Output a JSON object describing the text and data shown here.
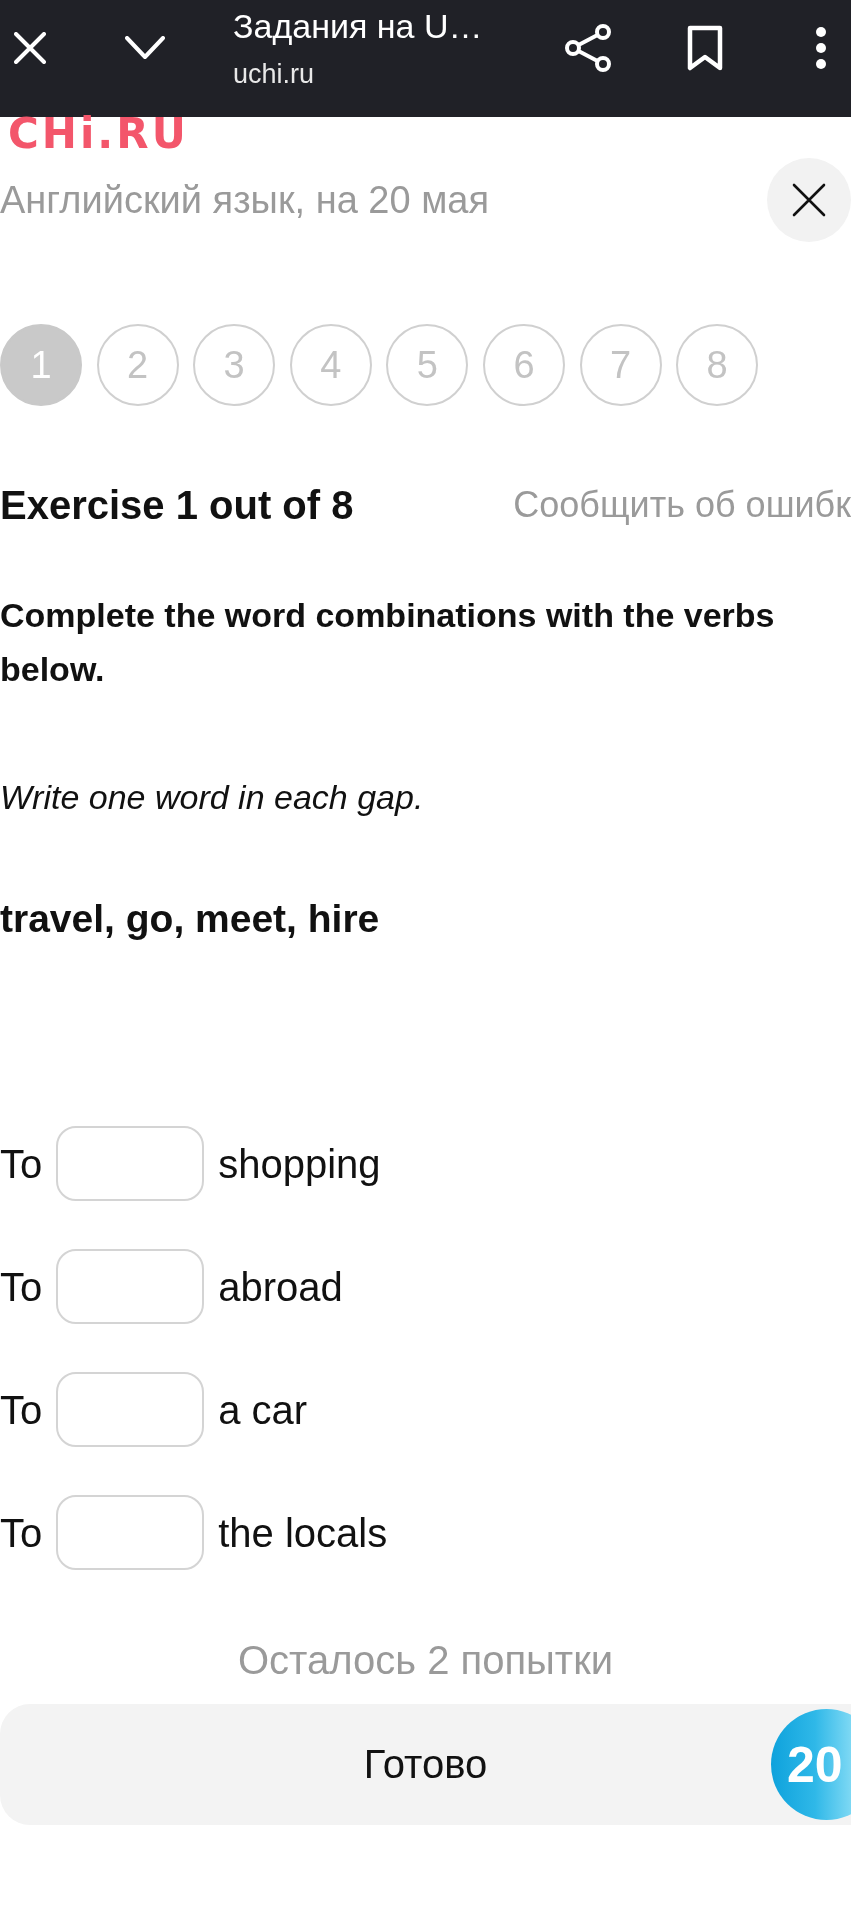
{
  "browser_bar": {
    "page_title": "Задания на U…",
    "url": "uchi.ru"
  },
  "logo": "CHi.RU",
  "subtitle": "Английский язык, на 20 мая",
  "steps": [
    {
      "label": "1",
      "selected": true
    },
    {
      "label": "2",
      "selected": false
    },
    {
      "label": "3",
      "selected": false
    },
    {
      "label": "4",
      "selected": false
    },
    {
      "label": "5",
      "selected": false
    },
    {
      "label": "6",
      "selected": false
    },
    {
      "label": "7",
      "selected": false
    },
    {
      "label": "8",
      "selected": false
    }
  ],
  "exercise": {
    "title": "Exercise 1 out of 8",
    "report_link": "Сообщить об ошибк",
    "instruction": "Complete the word combinations with the verbs below.",
    "hint": "Write one word in each gap.",
    "word_bank": "travel, go, meet, hire"
  },
  "gaps": [
    {
      "prefix": "To",
      "suffix": "shopping"
    },
    {
      "prefix": "To",
      "suffix": "abroad"
    },
    {
      "prefix": "To",
      "suffix": "a car"
    },
    {
      "prefix": "To",
      "suffix": "the locals"
    }
  ],
  "attempts": "Осталось 2 попытки",
  "submit_button": "Готово",
  "score_badge": "20"
}
